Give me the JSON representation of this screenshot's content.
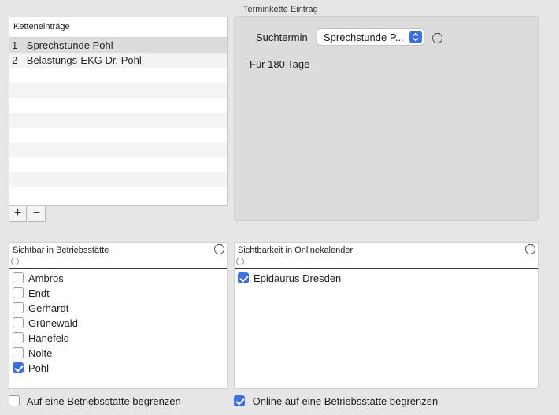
{
  "chain_list": {
    "header": "Ketteneinträge",
    "rows": [
      {
        "label": "1 - Sprechstunde Pohl",
        "selected": true
      },
      {
        "label": "2 - Belastungs-EKG Dr. Pohl",
        "selected": false
      },
      {
        "label": "",
        "selected": false
      },
      {
        "label": "",
        "selected": false
      },
      {
        "label": "",
        "selected": false
      },
      {
        "label": "",
        "selected": false
      },
      {
        "label": "",
        "selected": false
      },
      {
        "label": "",
        "selected": false
      },
      {
        "label": "",
        "selected": false
      },
      {
        "label": "",
        "selected": false
      },
      {
        "label": "",
        "selected": false
      }
    ],
    "add_label": "+",
    "remove_label": "−"
  },
  "entry": {
    "group_title": "Terminkette Eintrag",
    "search_label": "Suchtermin",
    "search_value": "Sprechstunde P...",
    "duration": "Für 180 Tage"
  },
  "sites_panel": {
    "title": "Sichtbar in Betriebsstätte",
    "items": [
      {
        "label": "Ambros",
        "checked": false
      },
      {
        "label": "Endt",
        "checked": false
      },
      {
        "label": "Gerhardt",
        "checked": false
      },
      {
        "label": "Grünewald",
        "checked": false
      },
      {
        "label": "Hanefeld",
        "checked": false
      },
      {
        "label": "Nolte",
        "checked": false
      },
      {
        "label": "Pohl",
        "checked": true
      }
    ]
  },
  "online_panel": {
    "title": "Sichtbarkeit in Onlinekalender",
    "items": [
      {
        "label": "Epidaurus Dresden",
        "checked": true
      }
    ]
  },
  "bottom": {
    "limit_site_label": "Auf eine Betriebsstätte begrenzen",
    "limit_site_checked": false,
    "limit_online_label": "Online auf eine Betriebsstätte begrenzen",
    "limit_online_checked": true
  },
  "colors": {
    "accent": "#3b6fe5",
    "background": "#e6e6e6"
  }
}
